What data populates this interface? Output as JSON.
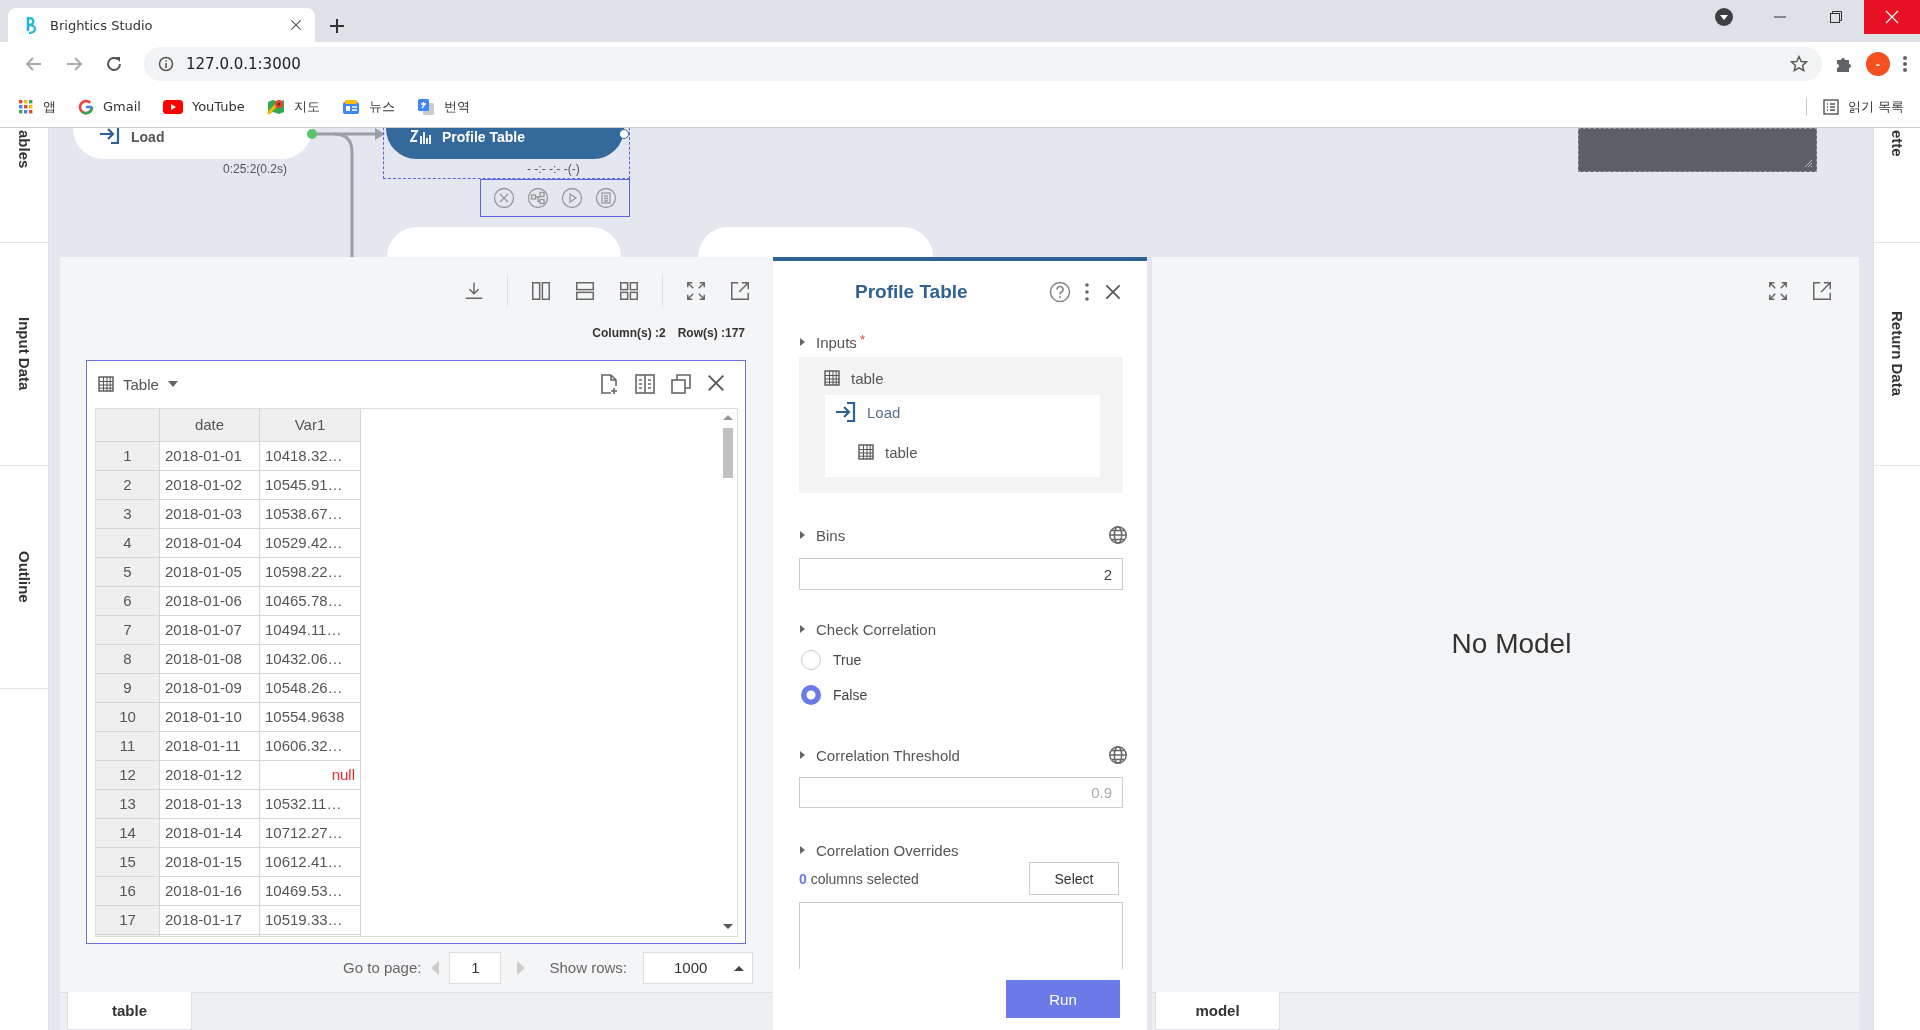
{
  "browser": {
    "tab": {
      "title": "Brightics Studio"
    },
    "address": "127.0.0.1:3000",
    "profile_badge": "-",
    "bookmarks": [
      {
        "label": "앱",
        "kind": "apps"
      },
      {
        "label": "Gmail",
        "kind": "gmail"
      },
      {
        "label": "YouTube",
        "kind": "youtube"
      },
      {
        "label": "지도",
        "kind": "maps"
      },
      {
        "label": "뉴스",
        "kind": "news"
      },
      {
        "label": "번역",
        "kind": "translate"
      }
    ],
    "reading_list": "읽기 목록"
  },
  "left_side_tabs": [
    {
      "label": "ables"
    },
    {
      "label": "Input Data"
    },
    {
      "label": "Outline"
    }
  ],
  "right_side_tabs": [
    {
      "label": "ette"
    },
    {
      "label": "Return Data"
    }
  ],
  "canvas": {
    "nodes": [
      {
        "label": "Load",
        "kind": "load",
        "selected": false,
        "status": "0:25:2(0.2s)"
      },
      {
        "label": "Profile Table",
        "kind": "profile",
        "selected": true,
        "status": "- -:- -:- -(-)"
      }
    ]
  },
  "result": {
    "columns_count": "Column(s) :2",
    "rows_count": "Row(s) :177",
    "table_title": "Table",
    "columns": [
      "date",
      "Var1"
    ],
    "rows": [
      {
        "index": "1",
        "date": "2018-01-01",
        "var1": "10418.32…",
        "is_null": false
      },
      {
        "index": "2",
        "date": "2018-01-02",
        "var1": "10545.91…",
        "is_null": false
      },
      {
        "index": "3",
        "date": "2018-01-03",
        "var1": "10538.67…",
        "is_null": false
      },
      {
        "index": "4",
        "date": "2018-01-04",
        "var1": "10529.42…",
        "is_null": false
      },
      {
        "index": "5",
        "date": "2018-01-05",
        "var1": "10598.22…",
        "is_null": false
      },
      {
        "index": "6",
        "date": "2018-01-06",
        "var1": "10465.78…",
        "is_null": false
      },
      {
        "index": "7",
        "date": "2018-01-07",
        "var1": "10494.11…",
        "is_null": false
      },
      {
        "index": "8",
        "date": "2018-01-08",
        "var1": "10432.06…",
        "is_null": false
      },
      {
        "index": "9",
        "date": "2018-01-09",
        "var1": "10548.26…",
        "is_null": false
      },
      {
        "index": "10",
        "date": "2018-01-10",
        "var1": "10554.9638",
        "is_null": false
      },
      {
        "index": "11",
        "date": "2018-01-11",
        "var1": "10606.32…",
        "is_null": false
      },
      {
        "index": "12",
        "date": "2018-01-12",
        "var1": "null",
        "is_null": true
      },
      {
        "index": "13",
        "date": "2018-01-13",
        "var1": "10532.11…",
        "is_null": false
      },
      {
        "index": "14",
        "date": "2018-01-14",
        "var1": "10712.27…",
        "is_null": false
      },
      {
        "index": "15",
        "date": "2018-01-15",
        "var1": "10612.41…",
        "is_null": false
      },
      {
        "index": "16",
        "date": "2018-01-16",
        "var1": "10469.53…",
        "is_null": false
      },
      {
        "index": "17",
        "date": "2018-01-17",
        "var1": "10519.33…",
        "is_null": false
      }
    ],
    "go_to_page_label": "Go to page:",
    "page": "1",
    "show_rows_label": "Show rows:",
    "show_rows": "1000",
    "tab": {
      "label": "table",
      "selected": true
    }
  },
  "properties": {
    "title": "Profile Table",
    "inputs": {
      "label": "Inputs",
      "required_mark": "*",
      "port": "table",
      "source": {
        "label": "Load",
        "port": "table"
      }
    },
    "bins": {
      "label": "Bins",
      "value": "2"
    },
    "check_correlation": {
      "label": "Check Correlation",
      "options": [
        {
          "label": "True",
          "selected": false
        },
        {
          "label": "False",
          "selected": true
        }
      ]
    },
    "correlation_threshold": {
      "label": "Correlation Threshold",
      "placeholder": "0.9"
    },
    "correlation_overrides": {
      "label": "Correlation Overrides",
      "summary": "**0** columns selected",
      "button": "Select"
    },
    "run_button": "Run"
  },
  "model": {
    "message": "No Model",
    "tab": {
      "label": "model",
      "selected": true
    }
  }
}
